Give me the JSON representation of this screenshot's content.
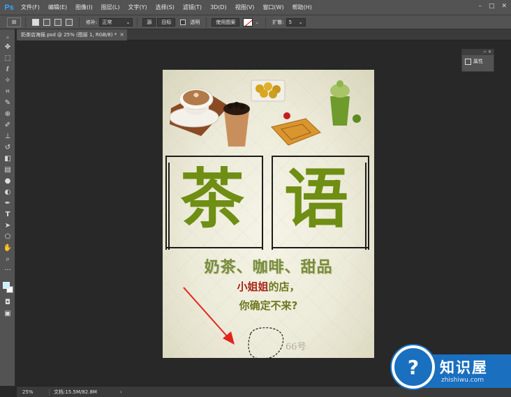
{
  "app": {
    "logo": "Ps"
  },
  "menu": [
    "文件(F)",
    "编辑(E)",
    "图像(I)",
    "图层(L)",
    "文字(Y)",
    "选择(S)",
    "滤镜(T)",
    "3D(D)",
    "视图(V)",
    "窗口(W)",
    "帮助(H)"
  ],
  "window_controls": {
    "minimize": "–",
    "maximize": "□",
    "close": "✕"
  },
  "options": {
    "feather_label": "修补:",
    "mode_value": "正常",
    "source_button": "源",
    "target_button": "目标",
    "transparent_label": "透明",
    "use_pattern_button": "使用图案",
    "diffusion_label": "扩散:",
    "diffusion_value": "5"
  },
  "tab": {
    "title": "奶茶店海报.psd @ 25% (图层 1, RGB/8) *",
    "close": "×"
  },
  "properties_panel": {
    "label": "属性",
    "header_icons": "›› ✕"
  },
  "status": {
    "zoom": "25%",
    "doc_size": "文档:15.5M/82.8M",
    "arrow": "›"
  },
  "poster": {
    "char_left": "茶",
    "char_right": "语",
    "subtitle": "奶茶、咖啡、甜品",
    "line2_highlight": "小姐姐",
    "line2_rest": "的店，",
    "line3": "你确定不来?",
    "mark_text": "66号"
  },
  "watermark": {
    "title": "知识屋",
    "url": "zhishiwu.com",
    "icon": "?"
  },
  "colors": {
    "accent_green": "#6f8e14",
    "brand_blue": "#1a6fbf",
    "highlight_red": "#a82318"
  },
  "tools": [
    "move-icon",
    "marquee-icon",
    "lasso-icon",
    "magic-wand-icon",
    "crop-icon",
    "eyedropper-icon",
    "patch-icon",
    "brush-icon",
    "stamp-icon",
    "history-brush-icon",
    "eraser-icon",
    "gradient-icon",
    "blur-icon",
    "dodge-icon",
    "pen-icon",
    "type-icon",
    "path-select-icon",
    "shape-icon",
    "hand-icon",
    "zoom-icon",
    "more-icon"
  ]
}
